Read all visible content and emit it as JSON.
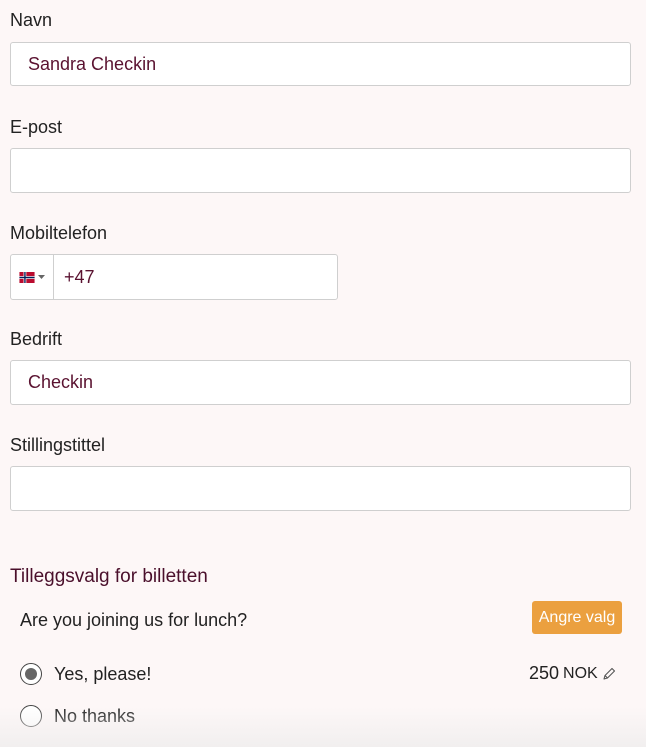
{
  "fields": {
    "name": {
      "label": "Navn",
      "value": "Sandra Checkin"
    },
    "email": {
      "label": "E-post",
      "value": ""
    },
    "mobile": {
      "label": "Mobiltelefon",
      "country_icon": "norway-flag-icon",
      "prefix": "+47"
    },
    "company": {
      "label": "Bedrift",
      "value": "Checkin"
    },
    "jobtitle": {
      "label": "Stillingstittel",
      "value": ""
    }
  },
  "addons": {
    "title": "Tilleggsvalg for billetten",
    "question": "Are you joining us for lunch?",
    "undo_label": "Angre valg",
    "options": [
      {
        "label": "Yes, please!",
        "selected": true,
        "price": "250",
        "currency": "NOK"
      },
      {
        "label": "No thanks",
        "selected": false
      }
    ],
    "accent_color": "#eba03f"
  }
}
